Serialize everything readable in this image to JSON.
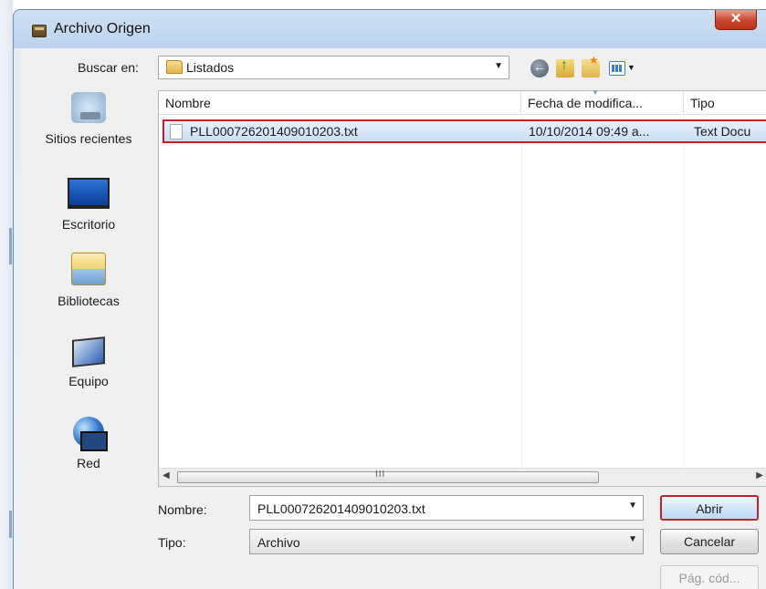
{
  "window": {
    "title": "Archivo Origen",
    "close_glyph": "✕"
  },
  "lookin": {
    "label": "Buscar en:",
    "value": "Listados"
  },
  "places": [
    {
      "label": "Sitios recientes",
      "icon": "recent-places-icon"
    },
    {
      "label": "Escritorio",
      "icon": "desktop-icon"
    },
    {
      "label": "Bibliotecas",
      "icon": "libraries-icon"
    },
    {
      "label": "Equipo",
      "icon": "computer-icon"
    },
    {
      "label": "Red",
      "icon": "network-icon"
    }
  ],
  "list": {
    "columns": [
      "Nombre",
      "Fecha de modifica...",
      "Tipo"
    ],
    "rows": [
      {
        "name": "PLL000726201409010203.txt",
        "date": "10/10/2014 09:49 a...",
        "type": "Text Docu"
      }
    ],
    "scroll_grip": "III"
  },
  "filename": {
    "label": "Nombre:",
    "value": "PLL000726201409010203.txt"
  },
  "filetype": {
    "label": "Tipo:",
    "value": "Archivo"
  },
  "buttons": {
    "open": "Abrir",
    "cancel": "Cancelar",
    "code_page": "Pág. cód..."
  }
}
